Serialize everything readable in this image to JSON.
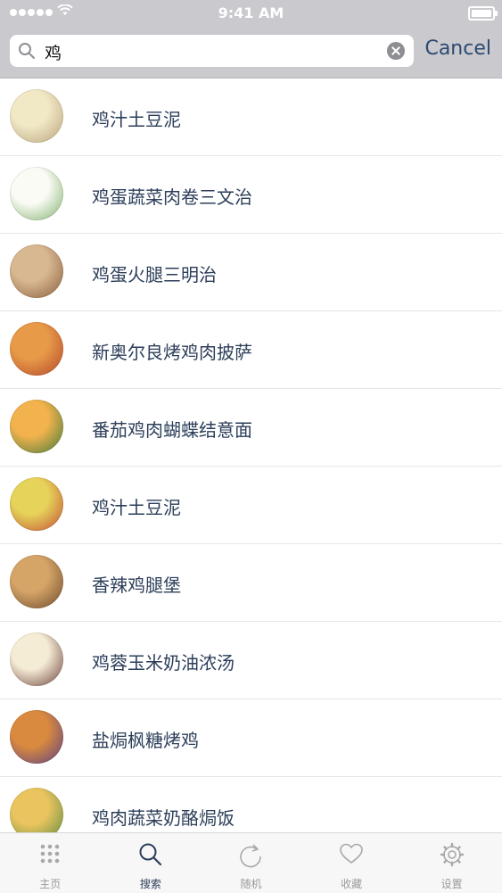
{
  "status_bar": {
    "time": "9:41 AM"
  },
  "search": {
    "query": "鸡",
    "cancel_label": "Cancel"
  },
  "results": [
    {
      "title": "鸡汁土豆泥",
      "thumb_colors": [
        "#f1e8c6",
        "#b8a47a"
      ]
    },
    {
      "title": "鸡蛋蔬菜肉卷三文治",
      "thumb_colors": [
        "#fbfbf6",
        "#7fb06a"
      ]
    },
    {
      "title": "鸡蛋火腿三明治",
      "thumb_colors": [
        "#d7b891",
        "#8b5c3c"
      ]
    },
    {
      "title": "新奥尔良烤鸡肉披萨",
      "thumb_colors": [
        "#e79a48",
        "#b4452b"
      ]
    },
    {
      "title": "番茄鸡肉蝴蝶结意面",
      "thumb_colors": [
        "#f2b24d",
        "#3f7a3b"
      ]
    },
    {
      "title": "鸡汁土豆泥",
      "thumb_colors": [
        "#e6d35a",
        "#c24d35"
      ]
    },
    {
      "title": "香辣鸡腿堡",
      "thumb_colors": [
        "#d5a467",
        "#6d4a2d"
      ]
    },
    {
      "title": "鸡蓉玉米奶油浓汤",
      "thumb_colors": [
        "#f5ecd5",
        "#6b3f3a"
      ]
    },
    {
      "title": "盐焗枫糖烤鸡",
      "thumb_colors": [
        "#d98a3e",
        "#5b3f86"
      ]
    },
    {
      "title": "鸡肉蔬菜奶酪焗饭",
      "thumb_colors": [
        "#e9c45f",
        "#5d8a3f"
      ]
    }
  ],
  "tabs": [
    {
      "label": "主页",
      "icon": "grid-icon",
      "active": false
    },
    {
      "label": "搜索",
      "icon": "search-icon",
      "active": true
    },
    {
      "label": "随机",
      "icon": "refresh-icon",
      "active": false
    },
    {
      "label": "收藏",
      "icon": "heart-icon",
      "active": false
    },
    {
      "label": "设置",
      "icon": "gear-icon",
      "active": false
    }
  ],
  "colors": {
    "header_bg": "#c9c9ce",
    "accent": "#2a4a6f",
    "text": "#2c3e5a",
    "tab_inactive": "#9a9a9a"
  }
}
